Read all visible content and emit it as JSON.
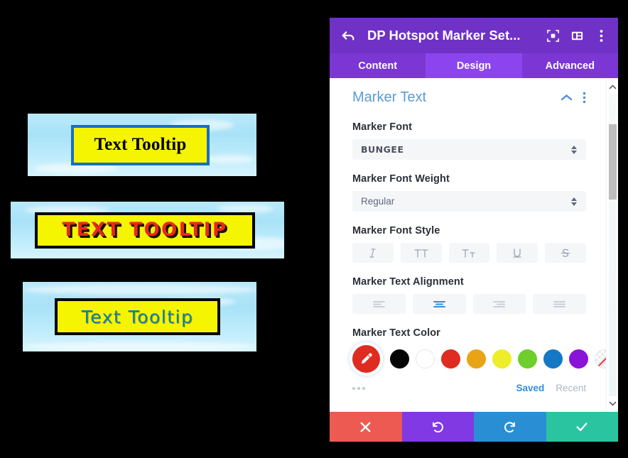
{
  "previews": [
    {
      "name": "serif-tooltip",
      "text": "Text Tooltip",
      "bg_color": "#f5f501",
      "border_color": "#1a6ec0",
      "text_color": "#000000",
      "sky_color": "#a9e2f7"
    },
    {
      "name": "bungee-tooltip",
      "text": "TEXT TOOLTIP",
      "bg_color": "#f5f501",
      "border_color": "#000000",
      "text_color": "#e8281e",
      "sky_color": "#a9e2f7"
    },
    {
      "name": "comic-tooltip",
      "text": "Text Tooltip",
      "bg_color": "#f5f501",
      "border_color": "#000000",
      "text_color": "#0f7fa8",
      "sky_color": "#a9e2f7"
    }
  ],
  "panel": {
    "header": {
      "title": "DP Hotspot Marker Set...",
      "back_icon": "back-arrow-icon",
      "focus_icon": "focus-target-icon",
      "layout_icon": "panel-layout-icon",
      "more_icon": "more-vertical-icon",
      "bg_color": "#7031c6"
    },
    "tabs": [
      {
        "label": "Content",
        "active": false
      },
      {
        "label": "Design",
        "active": true
      },
      {
        "label": "Advanced",
        "active": false
      }
    ],
    "section": {
      "title": "Marker Text",
      "collapse_icon": "chevron-up-icon",
      "menu_icon": "more-vertical-icon",
      "title_color": "#5b9bd5"
    },
    "fields": {
      "marker_font": {
        "label": "Marker Font",
        "value": "BUNGEE"
      },
      "marker_font_weight": {
        "label": "Marker Font Weight",
        "value": "Regular"
      },
      "marker_font_style": {
        "label": "Marker Font Style",
        "buttons": [
          {
            "name": "italic-button",
            "glyph": "I",
            "active": false
          },
          {
            "name": "uppercase-button",
            "glyph": "TT",
            "active": false
          },
          {
            "name": "small-caps-button",
            "glyph": "Tт",
            "active": false
          },
          {
            "name": "underline-button",
            "glyph": "U",
            "active": false
          },
          {
            "name": "strikethrough-button",
            "glyph": "S",
            "active": false
          }
        ]
      },
      "marker_text_alignment": {
        "label": "Marker Text Alignment",
        "buttons": [
          {
            "name": "align-left-button",
            "active": false
          },
          {
            "name": "align-center-button",
            "active": true
          },
          {
            "name": "align-right-button",
            "active": false
          },
          {
            "name": "align-justify-button",
            "active": false
          }
        ]
      },
      "marker_text_color": {
        "label": "Marker Text Color",
        "selected": "#e02b20",
        "eyedropper_icon": "eyedropper-icon",
        "swatches": [
          {
            "name": "swatch-black",
            "color": "#050505"
          },
          {
            "name": "swatch-white",
            "color": "#ffffff"
          },
          {
            "name": "swatch-red",
            "color": "#e02b20"
          },
          {
            "name": "swatch-orange",
            "color": "#e8a317"
          },
          {
            "name": "swatch-yellow",
            "color": "#eded2a"
          },
          {
            "name": "swatch-green",
            "color": "#6ece2a"
          },
          {
            "name": "swatch-blue",
            "color": "#1478c5"
          },
          {
            "name": "swatch-purple",
            "color": "#8b13d8"
          },
          {
            "name": "swatch-transparent",
            "color": "transparent"
          }
        ],
        "saved_label": "Saved",
        "recent_label": "Recent",
        "more_icon": "more-horizontal-icon"
      }
    },
    "scrollbar": {
      "up_icon": "chevron-up-icon",
      "down_icon": "chevron-down-icon"
    },
    "footer": [
      {
        "name": "cancel-button",
        "icon": "close-icon",
        "color": "#ed5a52"
      },
      {
        "name": "undo-button",
        "icon": "undo-icon",
        "color": "#8039e3"
      },
      {
        "name": "redo-button",
        "icon": "redo-icon",
        "color": "#2a8ed4"
      },
      {
        "name": "save-button",
        "icon": "checkmark-icon",
        "color": "#2bc4a0"
      }
    ]
  }
}
